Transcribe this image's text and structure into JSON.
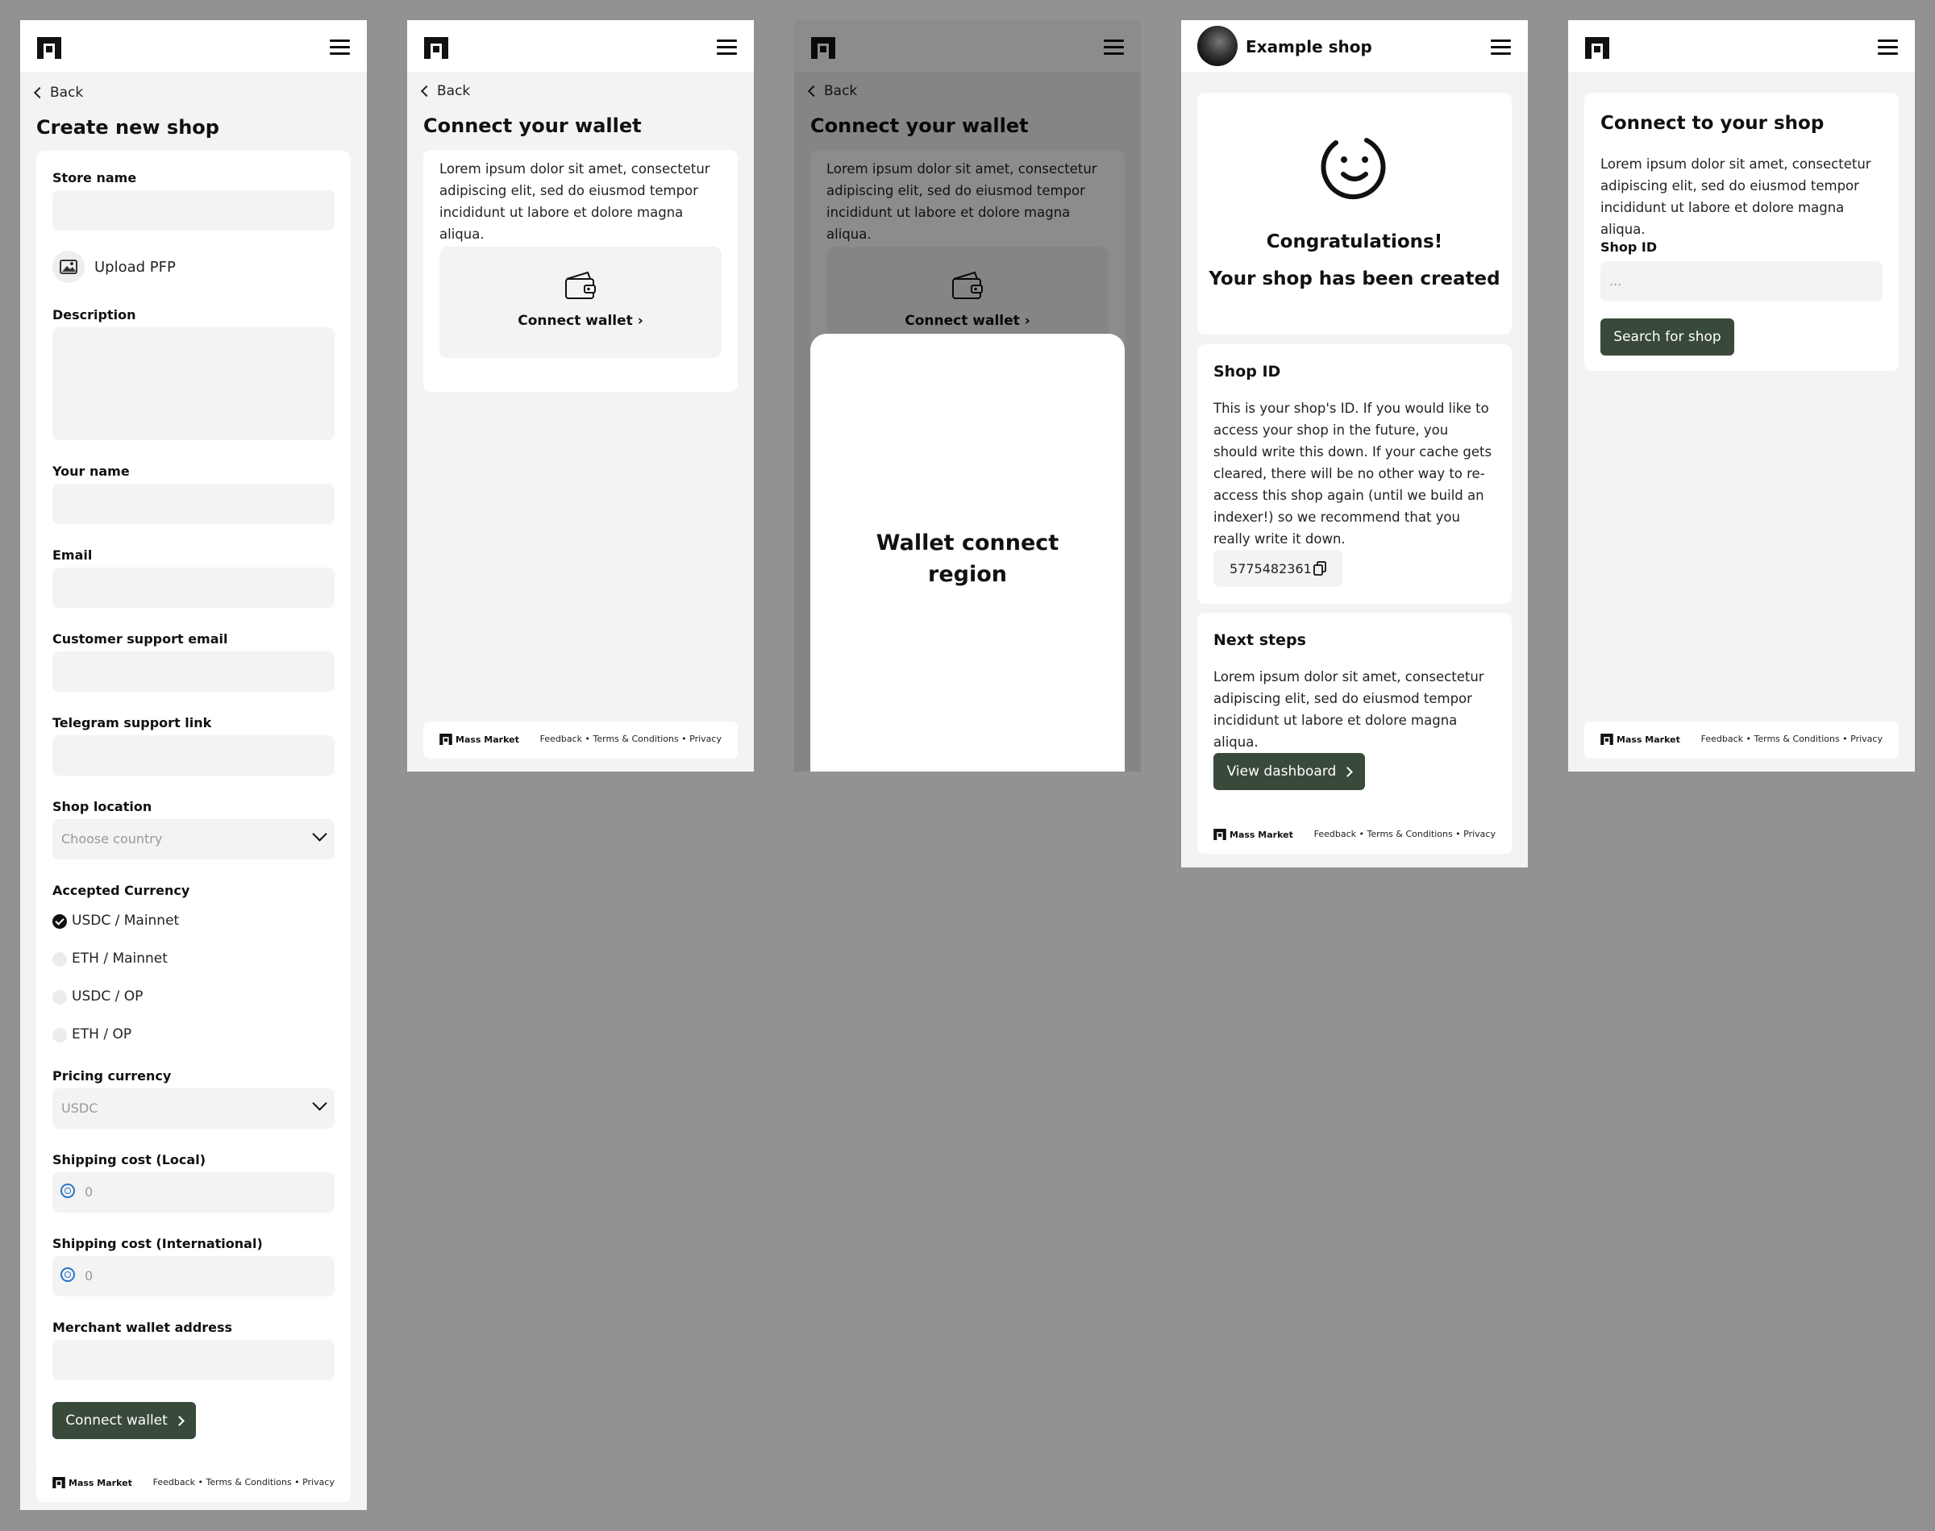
{
  "common": {
    "footer_brand": "Mass Market",
    "footer_links": "Feedback • Terms & Conditions • Privacy",
    "back_label": "Back"
  },
  "create_shop": {
    "title": "Create new shop",
    "store_name_label": "Store name",
    "upload_label": "Upload PFP",
    "description_label": "Description",
    "your_name_label": "Your name",
    "email_label": "Email",
    "support_email_label": "Customer support email",
    "telegram_label": "Telegram support link",
    "location_label": "Shop location",
    "location_placeholder": "Choose country",
    "currency_label": "Accepted Currency",
    "currencies": [
      {
        "label": "USDC / Mainnet",
        "checked": true
      },
      {
        "label": "ETH / Mainnet",
        "checked": false
      },
      {
        "label": "USDC / OP",
        "checked": false
      },
      {
        "label": "ETH / OP",
        "checked": false
      }
    ],
    "pricing_label": "Pricing currency",
    "pricing_value": "USDC",
    "shipping_local_label": "Shipping cost (Local)",
    "shipping_local_value": "0",
    "shipping_intl_label": "Shipping cost (International)",
    "shipping_intl_value": "0",
    "merchant_label": "Merchant wallet address",
    "connect_button": "Connect wallet"
  },
  "connect_wallet": {
    "title": "Connect your wallet",
    "body": "Lorem ipsum dolor sit amet, consectetur adipiscing elit, sed do eiusmod tempor incididunt ut labore et dolore magna aliqua.",
    "wallet_button": "Connect wallet ›"
  },
  "wallet_modal": {
    "region_text": "Wallet connect region"
  },
  "success": {
    "shop_name": "Example shop",
    "congrats": "Congratulations!",
    "created": "Your shop has been created",
    "shop_id_title": "Shop ID",
    "shop_id_body": "This is your shop's ID. If you would like to access your shop in the future, you should write this down. If your cache gets cleared, there will be no other way to re-access this shop again (until we build an indexer!) so we recommend that you really write it down.",
    "shop_id_value": "5775482361",
    "next_title": "Next steps",
    "next_body": "Lorem ipsum dolor sit amet, consectetur adipiscing elit, sed do eiusmod tempor incididunt ut labore et dolore magna aliqua.",
    "dashboard_button": "View dashboard"
  },
  "connect_shop": {
    "title": "Connect to your shop",
    "body": "Lorem ipsum dolor sit amet, consectetur adipiscing elit, sed do eiusmod tempor incididunt ut labore et dolore magna aliqua.",
    "shop_id_label": "Shop ID",
    "shop_id_placeholder": "...",
    "search_button": "Search for shop"
  }
}
